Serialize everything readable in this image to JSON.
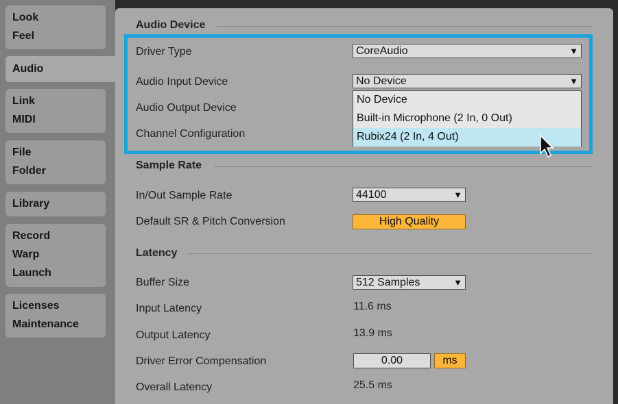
{
  "sidebar": {
    "tabs": [
      {
        "lines": [
          "Look",
          "Feel"
        ]
      },
      {
        "lines": [
          "Audio"
        ]
      },
      {
        "lines": [
          "Link",
          "MIDI"
        ]
      },
      {
        "lines": [
          "File",
          "Folder"
        ]
      },
      {
        "lines": [
          "Library"
        ]
      },
      {
        "lines": [
          "Record",
          "Warp",
          "Launch"
        ]
      },
      {
        "lines": [
          "Licenses",
          "Maintenance"
        ]
      }
    ]
  },
  "audio_device": {
    "title": "Audio Device",
    "driver_type_label": "Driver Type",
    "driver_type_value": "CoreAudio",
    "input_device_label": "Audio Input Device",
    "input_device_value": "No Device",
    "output_device_label": "Audio Output Device",
    "channel_config_label": "Channel Configuration",
    "dropdown_options": [
      "No Device",
      "Built-in Microphone (2 In, 0 Out)",
      "Rubix24 (2 In, 4 Out)"
    ]
  },
  "sample_rate": {
    "title": "Sample Rate",
    "inout_label": "In/Out Sample Rate",
    "inout_value": "44100",
    "conversion_label": "Default SR & Pitch Conversion",
    "conversion_value": "High Quality"
  },
  "latency": {
    "title": "Latency",
    "buffer_label": "Buffer Size",
    "buffer_value": "512 Samples",
    "input_label": "Input Latency",
    "input_value": "11.6 ms",
    "output_label": "Output Latency",
    "output_value": "13.9 ms",
    "comp_label": "Driver Error Compensation",
    "comp_value": "0.00",
    "comp_unit": "ms",
    "overall_label": "Overall Latency",
    "overall_value": "25.5 ms"
  },
  "colors": {
    "highlight_border": "#1aa3dc",
    "accent_orange": "#fdb53a",
    "selected_option": "#bfe6f3"
  }
}
